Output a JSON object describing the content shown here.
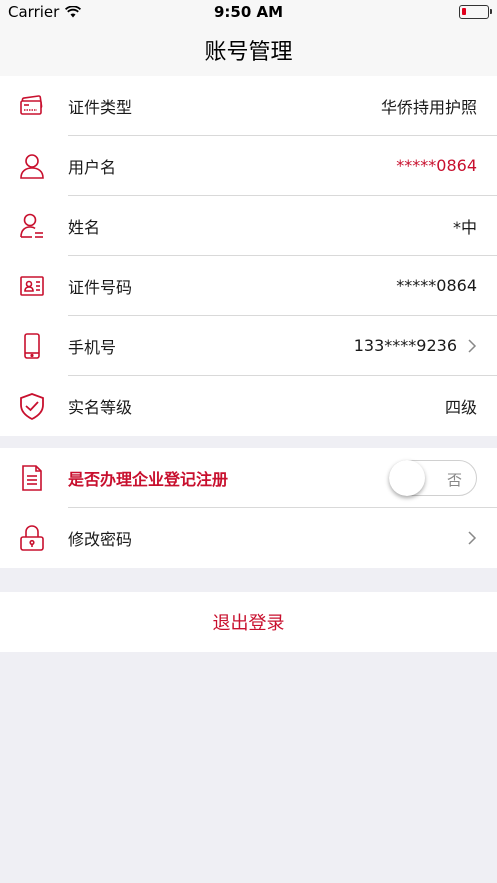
{
  "status_bar": {
    "carrier": "Carrier",
    "time": "9:50 AM",
    "battery_level": 0.1
  },
  "nav": {
    "title": "账号管理"
  },
  "account_rows": [
    {
      "icon": "id-card-icon",
      "label": "证件类型",
      "value": "华侨持用护照"
    },
    {
      "icon": "user-icon",
      "label": "用户名",
      "value": "*****0864"
    },
    {
      "icon": "person-name-icon",
      "label": "姓名",
      "value": "*中"
    },
    {
      "icon": "id-number-icon",
      "label": "证件号码",
      "value": "*****0864"
    },
    {
      "icon": "phone-icon",
      "label": "手机号",
      "value": "133****9236"
    },
    {
      "icon": "shield-check-icon",
      "label": "实名等级",
      "value": "四级"
    }
  ],
  "settings": {
    "enterprise": {
      "icon": "document-icon",
      "label": "是否办理企业登记注册",
      "toggle_text": "否",
      "toggle_on": false
    },
    "password": {
      "icon": "lock-icon",
      "label": "修改密码"
    }
  },
  "logout": {
    "label": "退出登录"
  },
  "colors": {
    "accent": "#c8102e",
    "background": "#efeff4"
  }
}
